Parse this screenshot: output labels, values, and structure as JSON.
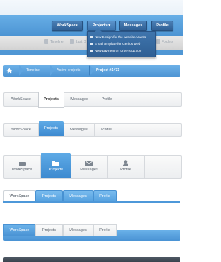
{
  "header": {
    "tabs": [
      "WorkSpace",
      "Projects",
      "Messages",
      "Profile"
    ],
    "projects_caret": "▾",
    "subnav": [
      "Timeline",
      "Last D",
      "Folders"
    ],
    "dropdown": [
      "New Design for the website Aractis",
      "Email template for Genius Web",
      "New payment on driverstop.com"
    ]
  },
  "breadcrumb": {
    "items": [
      "Timeline",
      "Active projects",
      "Project #1473"
    ]
  },
  "bar3": {
    "tabs": [
      "WorkSpace",
      "Projects",
      "Messages",
      "Profile"
    ],
    "active": "Projects"
  },
  "bar4": {
    "tabs": [
      "WorkSpace",
      "Projects",
      "Messages",
      "Profile"
    ],
    "active": "Projects"
  },
  "bar5": {
    "tabs": [
      "WorkSpace",
      "Projects",
      "Messages",
      "Profile"
    ],
    "icons": [
      "briefcase-icon",
      "folder-icon",
      "envelope-icon",
      "user-icon"
    ],
    "active": "Projects"
  },
  "bar6": {
    "tabs": [
      "WorkSpace",
      "Projects",
      "Messages",
      "Profile"
    ],
    "active": "WorkSpace"
  },
  "bar7": {
    "tabs": [
      "WorkSpace",
      "Projects",
      "Messages",
      "Profile"
    ],
    "active": "WorkSpace"
  },
  "colors": {
    "accent_blue": "#4e96d4",
    "dark_blue": "#2f5f94",
    "strip": "#3e4751"
  }
}
